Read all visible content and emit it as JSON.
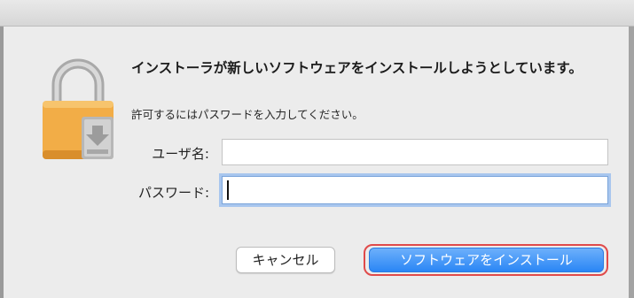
{
  "dialog": {
    "title": "インストーラが新しいソフトウェアをインストールしようとしています。",
    "subtitle": "許可するにはパスワードを入力してください。",
    "icon": "lock-icon"
  },
  "form": {
    "username_label": "ユーザ名:",
    "username_value": "",
    "password_label": "パスワード:",
    "password_value": ""
  },
  "buttons": {
    "cancel_label": "キャンセル",
    "install_label": "ソフトウェアをインストール"
  },
  "colors": {
    "primary_button": "#2a86f5",
    "focus_ring": "#a8c6ee",
    "highlight_ring": "#e04a4a",
    "lock_body": "#f2ad47"
  }
}
